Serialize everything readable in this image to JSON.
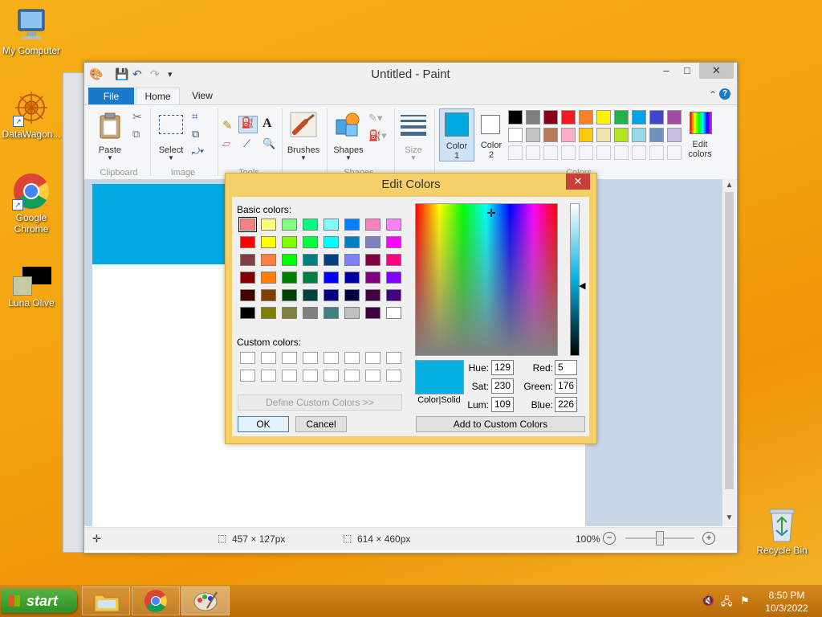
{
  "desktop": {
    "icons": [
      {
        "label": "My Computer"
      },
      {
        "label": "DataWagon..."
      },
      {
        "label": "Google Chrome"
      },
      {
        "label": "Luna Olive"
      },
      {
        "label": "Recycle Bin"
      }
    ]
  },
  "paint": {
    "title": "Untitled - Paint",
    "tabs": {
      "file": "File",
      "home": "Home",
      "view": "View"
    },
    "groups": {
      "clipboard": "Clipboard",
      "image": "Image",
      "tools": "Tools",
      "shapes": "Shapes",
      "colors": "Colors"
    },
    "buttons": {
      "paste": "Paste",
      "select": "Select",
      "brushes": "Brushes",
      "shapes": "Shapes",
      "size": "Size",
      "color1_line1": "Color",
      "color1_line2": "1",
      "color2_line1": "Color",
      "color2_line2": "2",
      "edit_colors_line1": "Edit",
      "edit_colors_line2": "colors"
    },
    "palette": [
      "#000000",
      "#7f7f7f",
      "#880015",
      "#ed1c24",
      "#ff7f27",
      "#fff200",
      "#22b14c",
      "#00a2e8",
      "#3f48cc",
      "#a349a4",
      "#ffffff",
      "#c3c3c3",
      "#b97a57",
      "#ffaec9",
      "#ffc90e",
      "#efe4b0",
      "#b5e61d",
      "#99d9ea",
      "#7092be",
      "#c8bfe7"
    ],
    "color1": "#00a9e0",
    "color2": "#ffffff",
    "drawn_rect_color": "#00a9e0",
    "status": {
      "selection": "457 × 127px",
      "size": "614 × 460px",
      "zoom": "100%"
    }
  },
  "dialog": {
    "title": "Edit Colors",
    "basic_label": "Basic colors:",
    "custom_label": "Custom colors:",
    "basic_colors": [
      "#ff8080",
      "#ffff80",
      "#80ff80",
      "#00ff80",
      "#80ffff",
      "#0080ff",
      "#ff80c0",
      "#ff80ff",
      "#ff0000",
      "#ffff00",
      "#80ff00",
      "#00ff40",
      "#00ffff",
      "#0080c0",
      "#8080c0",
      "#ff00ff",
      "#804040",
      "#ff8040",
      "#00ff00",
      "#008080",
      "#004080",
      "#8080ff",
      "#800040",
      "#ff0080",
      "#800000",
      "#ff8000",
      "#008000",
      "#008040",
      "#0000ff",
      "#0000a0",
      "#800080",
      "#8000ff",
      "#400000",
      "#804000",
      "#004000",
      "#004040",
      "#000080",
      "#000040",
      "#400040",
      "#400080",
      "#000000",
      "#808000",
      "#808040",
      "#808080",
      "#408080",
      "#c0c0c0",
      "#400040",
      "#ffffff"
    ],
    "define_button": "Define Custom Colors >>",
    "ok": "OK",
    "cancel": "Cancel",
    "add_button": "Add to Custom Colors",
    "color_solid": "Color|Solid",
    "preview_color": "#05b0e2",
    "fields": {
      "hue_label": "Hue:",
      "hue": "129",
      "sat_label": "Sat:",
      "sat": "230",
      "lum_label": "Lum:",
      "lum": "109",
      "red_label": "Red:",
      "red": "5",
      "green_label": "Green:",
      "green": "176",
      "blue_label": "Blue:",
      "blue": "226"
    }
  },
  "taskbar": {
    "start": "start",
    "time": "8:50 PM",
    "date": "10/3/2022"
  }
}
